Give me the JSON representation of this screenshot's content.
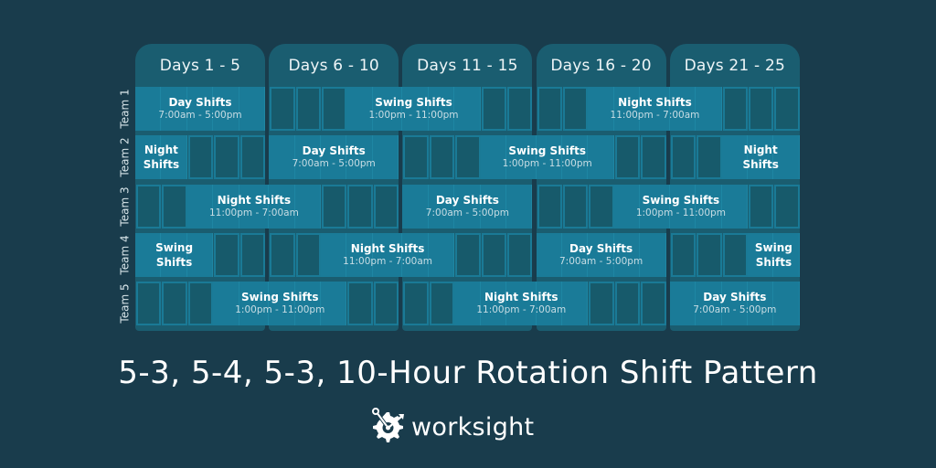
{
  "title": "5-3, 5-4, 5-3, 10-Hour Rotation Shift Pattern",
  "brand": {
    "name": "worksight",
    "icon": "gear-arrow-logo-icon"
  },
  "colors": {
    "background": "#193c4c",
    "panel": "#1a5d70",
    "work_cell": "#1a7b98",
    "off_cell": "#175a6b",
    "text": "#ffffff"
  },
  "periods": [
    "Days 1 - 5",
    "Days 6 - 10",
    "Days 11 - 15",
    "Days 16 - 20",
    "Days 21 - 25"
  ],
  "shift_types": {
    "day": {
      "name": "Day Shifts",
      "time": "7:00am - 5:00pm"
    },
    "swing": {
      "name": "Swing Shifts",
      "time": "1:00pm - 11:00pm"
    },
    "night": {
      "name": "Night Shifts",
      "time": "11:00pm - 7:00am"
    }
  },
  "teams": [
    {
      "label": "Team 1",
      "blocks": [
        {
          "shift": "day",
          "start": 1,
          "end": 5,
          "name": "Day Shifts",
          "time": "7:00am - 5:00pm"
        },
        {
          "shift": "swing",
          "start": 9,
          "end": 13,
          "name": "Swing Shifts",
          "time": "1:00pm - 11:00pm"
        },
        {
          "shift": "night",
          "start": 18,
          "end": 22,
          "name": "Night Shifts",
          "time": "11:00pm - 7:00am"
        }
      ]
    },
    {
      "label": "Team 2",
      "blocks": [
        {
          "shift": "night",
          "start": 1,
          "end": 2,
          "name": "Night Shifts",
          "time": ""
        },
        {
          "shift": "day",
          "start": 6,
          "end": 10,
          "name": "Day Shifts",
          "time": "7:00am - 5:00pm"
        },
        {
          "shift": "swing",
          "start": 14,
          "end": 18,
          "name": "Swing Shifts",
          "time": "1:00pm - 11:00pm"
        },
        {
          "shift": "night",
          "start": 23,
          "end": 25,
          "name": "Night Shifts",
          "time": ""
        }
      ]
    },
    {
      "label": "Team 3",
      "blocks": [
        {
          "shift": "night",
          "start": 3,
          "end": 7,
          "name": "Night Shifts",
          "time": "11:00pm - 7:00am"
        },
        {
          "shift": "day",
          "start": 11,
          "end": 15,
          "name": "Day Shifts",
          "time": "7:00am - 5:00pm"
        },
        {
          "shift": "swing",
          "start": 19,
          "end": 23,
          "name": "Swing Shifts",
          "time": "1:00pm - 11:00pm"
        }
      ]
    },
    {
      "label": "Team 4",
      "blocks": [
        {
          "shift": "swing",
          "start": 1,
          "end": 3,
          "name": "Swing Shifts",
          "time": ""
        },
        {
          "shift": "night",
          "start": 8,
          "end": 12,
          "name": "Night Shifts",
          "time": "11:00pm - 7:00am"
        },
        {
          "shift": "day",
          "start": 16,
          "end": 20,
          "name": "Day Shifts",
          "time": "7:00am - 5:00pm"
        },
        {
          "shift": "swing",
          "start": 24,
          "end": 25,
          "name": "Swing Shifts",
          "time": ""
        }
      ]
    },
    {
      "label": "Team 5",
      "blocks": [
        {
          "shift": "swing",
          "start": 4,
          "end": 8,
          "name": "Swing Shifts",
          "time": "1:00pm - 11:00pm"
        },
        {
          "shift": "night",
          "start": 13,
          "end": 17,
          "name": "Night Shifts",
          "time": "11:00pm - 7:00am"
        },
        {
          "shift": "day",
          "start": 21,
          "end": 25,
          "name": "Day Shifts",
          "time": "7:00am - 5:00pm"
        }
      ]
    }
  ],
  "total_days": 25
}
